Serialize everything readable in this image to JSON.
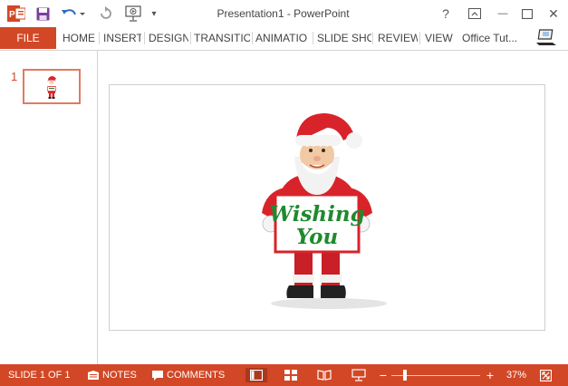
{
  "window": {
    "title": "Presentation1 - PowerPoint",
    "help_label": "?",
    "minimize_label": "—",
    "close_label": "✕"
  },
  "quick_access": {
    "app_icon": "powerpoint-logo-icon",
    "items": [
      "save-icon",
      "undo-icon",
      "redo-icon",
      "start-from-beginning-icon",
      "customize-quick-access-icon"
    ],
    "customize_glyph": "▾"
  },
  "ribbon": {
    "file_label": "FILE",
    "tabs": [
      "HOME",
      "INSERT",
      "DESIGN",
      "TRANSITIO",
      "ANIMATIO",
      "SLIDE SHO",
      "REVIEW",
      "VIEW"
    ],
    "account_name": "Office Tut...",
    "avatar_icon": "laptop-user-icon"
  },
  "thumbnails": [
    {
      "number": "1",
      "selected": true
    }
  ],
  "slide": {
    "sign_text_line1": "Wishing",
    "sign_text_line2": "You"
  },
  "status": {
    "slide_indicator": "SLIDE 1 OF 1",
    "notes_label": "NOTES",
    "comments_label": "COMMENTS",
    "views": [
      "normal-view-icon",
      "slide-sorter-icon",
      "reading-view-icon",
      "slide-show-icon"
    ],
    "zoom_out": "−",
    "zoom_in": "+",
    "zoom_level_value": 0.37,
    "zoom": "37%",
    "fit_icon": "fit-slide-to-window-icon"
  },
  "colors": {
    "accent": "#d24726",
    "accent_dark": "#a8391d",
    "sign_text": "#1f8a2e",
    "sign_border": "#d9232a"
  }
}
